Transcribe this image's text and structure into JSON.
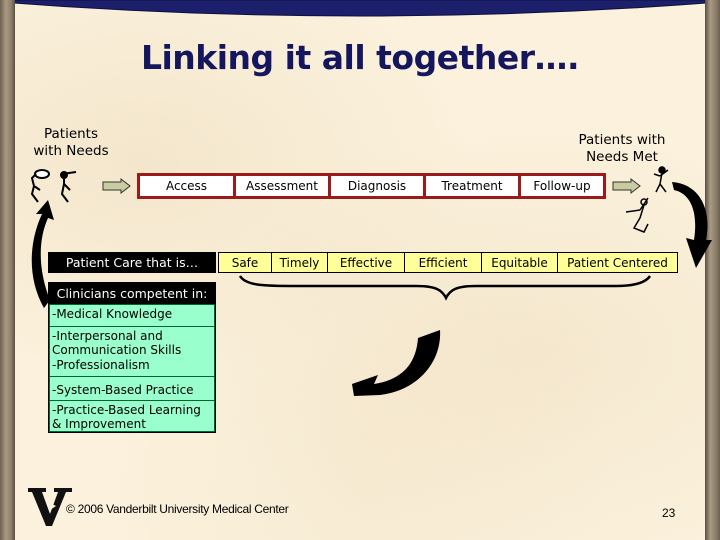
{
  "slide": {
    "title": "Linking it all together….",
    "page_number": "23",
    "footer": "©  2006 Vanderbilt University Medical Center",
    "colors": {
      "title": "#14165e",
      "process_border": "#9b1b1b",
      "quality_fill": "#ffff99",
      "competency_fill": "#99ffcc",
      "header_band": "#1c1f6b"
    }
  },
  "start_label": "Patients with Needs",
  "end_label": "Patients with Needs Met",
  "process_steps": [
    "Access",
    "Assessment",
    "Diagnosis",
    "Treatment",
    "Follow-up"
  ],
  "quality": {
    "header": "Patient Care that is…",
    "aims": [
      "Safe",
      "Timely",
      "Effective",
      "Efficient",
      "Equitable",
      "Patient Centered"
    ]
  },
  "competencies": {
    "header": "Clinicians competent in:",
    "items": [
      "-Medical Knowledge",
      "-Interpersonal and Communication Skills",
      "-Professionalism",
      "-System-Based Practice",
      "-Practice-Based Learning & Improvement"
    ]
  },
  "icons": {
    "logo": "vanderbilt-v-logo",
    "start_figures": "stick-figures-in-need",
    "end_figures": "stick-figures-celebrating",
    "flow_arrow": "right-arrow",
    "cycle_arrow": "curved-arrow"
  }
}
